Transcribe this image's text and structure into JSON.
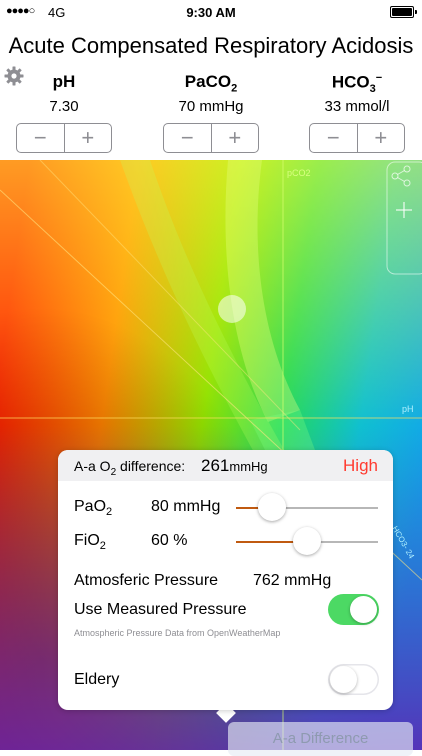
{
  "status_bar": {
    "carrier": "4G",
    "time": "9:30 AM"
  },
  "title": "Acute Compensated Respiratory Acidosis",
  "params": [
    {
      "name": "pH",
      "value": "7.30"
    },
    {
      "name": "PaCO2",
      "value": "70 mmHg"
    },
    {
      "name": "HCO3−",
      "value": "33 mmol/l"
    }
  ],
  "chart": {
    "label_pco2": "pCO2",
    "label_ph": "pH",
    "label_hco3": "HCO3- 24"
  },
  "card": {
    "header_label": "A-a O2 difference:",
    "header_value": "261",
    "header_unit": "mmHg",
    "header_status": "High",
    "pao2_label": "PaO2",
    "pao2_value": "80 mmHg",
    "pao2_level": 0.25,
    "fio2_label": "FiO2",
    "fio2_value": "60 %",
    "fio2_level": 0.5,
    "pressure_label": "Atmosferic Pressure",
    "pressure_value": "762 mmHg",
    "measured_label": "Use Measured Pressure",
    "measured_on": true,
    "footnote": "Atmospheric Pressure Data from OpenWeatherMap",
    "elderly_label": "Eldery",
    "elderly_on": false
  },
  "bottom_tab": "A-a Difference",
  "colors": {
    "accent_green": "#4cd964",
    "slider_fill": "#c05a10",
    "status_high": "#ff3b30"
  }
}
